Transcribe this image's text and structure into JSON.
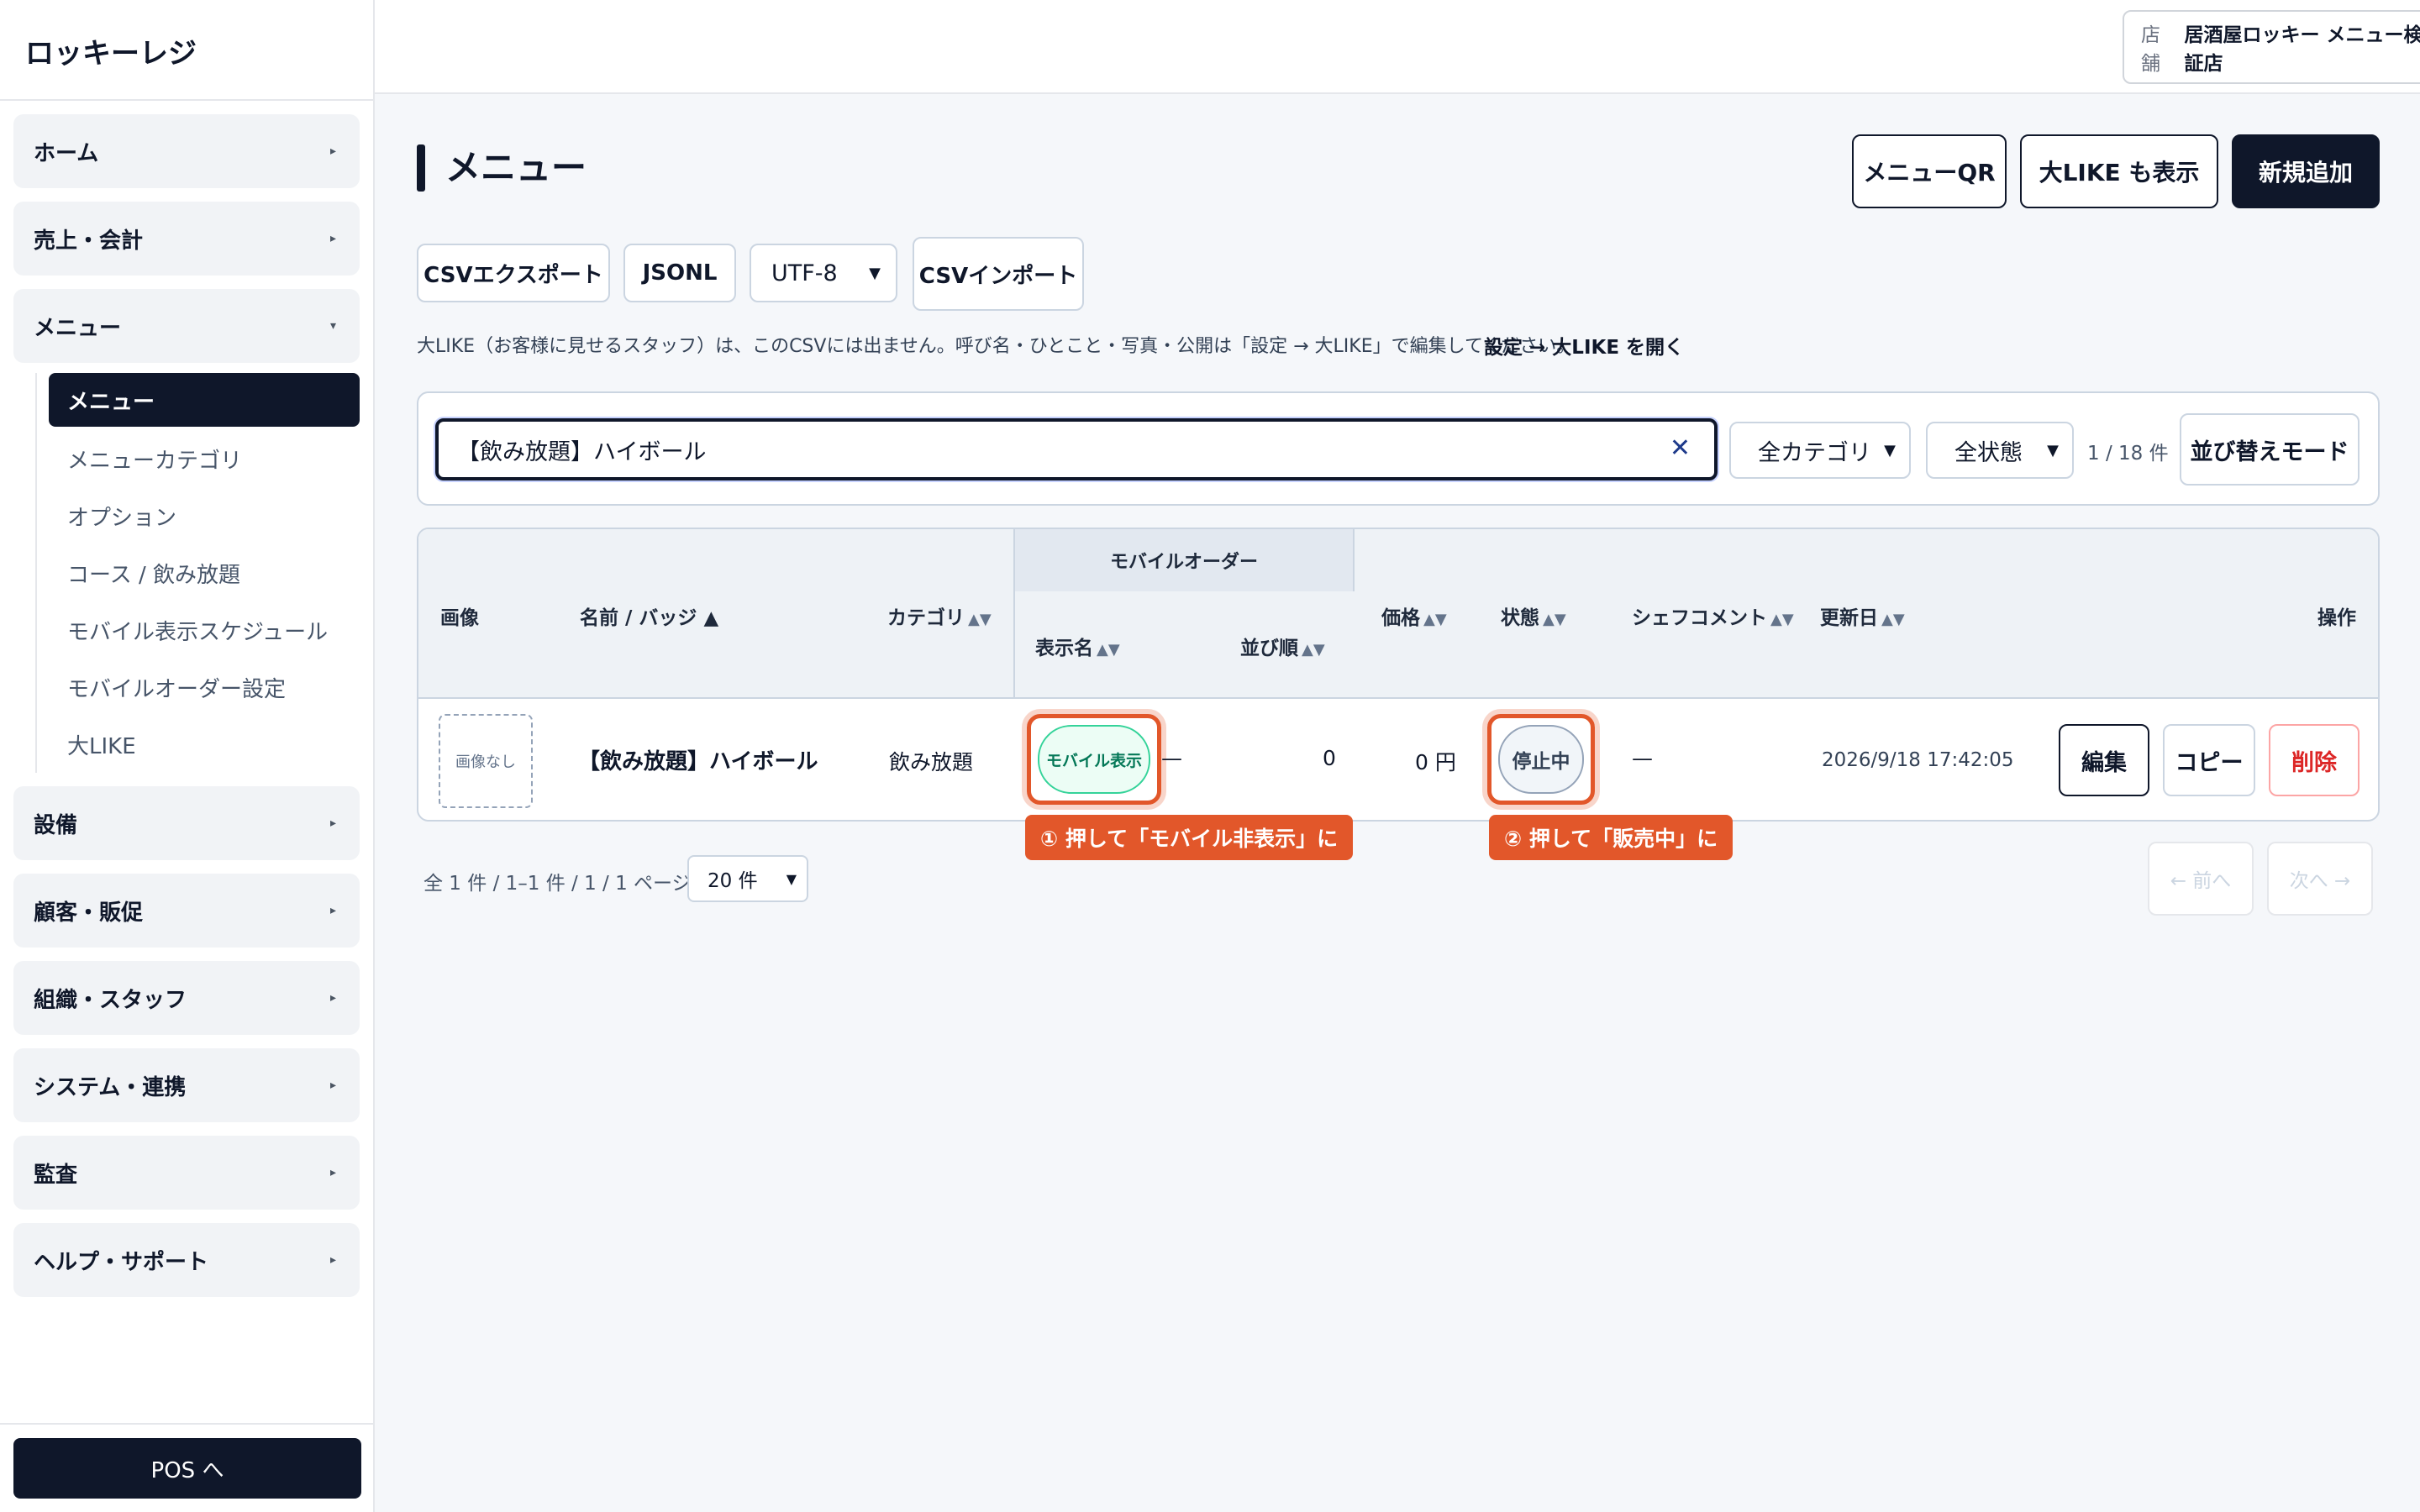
{
  "app": {
    "brand": "ロッキーレジ"
  },
  "sidebar": {
    "groups": [
      {
        "label": "ホーム",
        "caret": "▸"
      },
      {
        "label": "売上・会計",
        "caret": "▸"
      },
      {
        "label": "メニュー",
        "caret": "▾"
      },
      {
        "label": "設備",
        "caret": "▸"
      },
      {
        "label": "顧客・販促",
        "caret": "▸"
      },
      {
        "label": "組織・スタッフ",
        "caret": "▸"
      },
      {
        "label": "システム・連携",
        "caret": "▸"
      },
      {
        "label": "監査",
        "caret": "▸"
      },
      {
        "label": "ヘルプ・サポート",
        "caret": "▸"
      }
    ],
    "menu_items": [
      "メニュー",
      "メニューカテゴリ",
      "オプション",
      "コース / 飲み放題",
      "モバイル表示スケジュール",
      "モバイルオーダー設定",
      "大LIKE"
    ],
    "pos_button": "POS へ"
  },
  "topbar": {
    "store_label": "店舗",
    "store_value": "居酒屋ロッキー メニュー検証店",
    "chevron": "⌄"
  },
  "page": {
    "title": "メニュー",
    "buttons": {
      "menu_qr": "メニューQR",
      "show_like": "大LIKE も表示",
      "add_new": "新規追加"
    },
    "tools": {
      "csv_export": "CSVエクスポート",
      "jsonl": "JSONL",
      "encoding": "UTF-8",
      "csv_import": "CSVインポート"
    },
    "notice": "大LIKE（お客様に見せるスタッフ）は、このCSVには出ません。呼び名・ひとこと・写真・公開は「設定 → 大LIKE」で編集してください。",
    "notice_link": "設定 → 大LIKE を開く"
  },
  "filters": {
    "search_value": "【飲み放題】ハイボール",
    "clear_icon": "✕",
    "category": "全カテゴリ",
    "status": "全状態",
    "count": "1 / 18 件",
    "sort_mode": "並び替えモード"
  },
  "table": {
    "group_header": "モバイルオーダー",
    "headers": {
      "image": "画像",
      "name": "名前 / バッジ",
      "name_sort": "▲",
      "category": "カテゴリ",
      "display_name": "表示名",
      "order": "並び順",
      "price": "価格",
      "status": "状態",
      "chef_comment": "シェフコメント",
      "updated": "更新日",
      "actions": "操作",
      "sort_icon": "▲▼"
    },
    "rows": [
      {
        "image_placeholder": "画像なし",
        "name": "【飲み放題】ハイボール",
        "category": "飲み放題",
        "mobile_toggle": "モバイル表示",
        "display_name": "—",
        "order": "0",
        "price": "0 円",
        "status": "停止中",
        "chef_comment": "—",
        "updated": "2026/9/18 17:42:05",
        "edit": "編集",
        "copy": "コピー",
        "delete": "削除"
      }
    ]
  },
  "callouts": {
    "one": "① 押して「モバイル非表示」に",
    "two": "② 押して「販売中」に"
  },
  "pager": {
    "summary": "全 1 件 / 1–1 件 / 1 / 1 ページ",
    "page_size": "20 件",
    "prev": "← 前へ",
    "next": "次へ →"
  },
  "colors": {
    "primary": "#0f172a",
    "accent": "#e2572a",
    "green": "#047857",
    "danger": "#dc2626"
  }
}
